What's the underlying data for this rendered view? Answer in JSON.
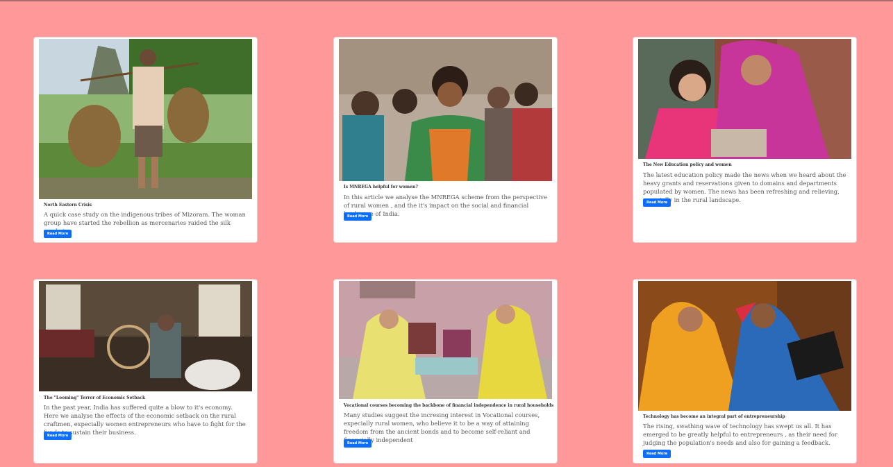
{
  "cards": [
    {
      "image_name": "woman-carrying-baskets-rice-field-image",
      "title": "North Eastern Crisis",
      "description": "A quick case study on the indigenous tribes of Mizoram. The woman group have started the rebellion as mercenaries raided the silk market.",
      "button": "Read More"
    },
    {
      "image_name": "group-of-rural-women-image",
      "title": "Is MNREGA helpful for women?",
      "description": "In this article we analyse the MNREGA scheme from the perspective of rural women , and the it's impact on the social and financial landscape of India.",
      "button": "Read More"
    },
    {
      "image_name": "women-with-tablet-image",
      "title": "The New Education policy and women",
      "description": "The latest education policy made the news when we heard about the heavy grants and reservations given to domains and departments populated by women. The news has been refreshing and relieving, especially in the rural landscape.",
      "button": "Read More"
    },
    {
      "image_name": "woman-spinning-wool-image",
      "title": "The \"Looming\" Terror of Economic Setback",
      "description": "In the past year, India has suffered quite a blow to it's economy. Here we analyse the effects of the economic setback on the rural craftmen, expecially women entrepreneurs who have to fight for the funds to sustain their business.",
      "button": "Read More"
    },
    {
      "image_name": "women-sewing-vocational-course-image",
      "title": "Vocational courses becoming the backbone of financial independence in rural households",
      "description": "Many studies suggest the incresing interest in Vocational courses, expecially rural women, who believe it to be a way of attaining freedom from the ancient bonds and to become self-reliant and financially independent",
      "button": "Read More"
    },
    {
      "image_name": "women-using-laptop-image",
      "title": "Technology has become an integral part of entrepreneurship",
      "description": "The rising, swathing wave of technology has swept us all. It has emerged to be greatly helpful to entrepreneurs , as their need for judging the population's needs and also for gaining a feedback.",
      "button": "Read More"
    }
  ]
}
